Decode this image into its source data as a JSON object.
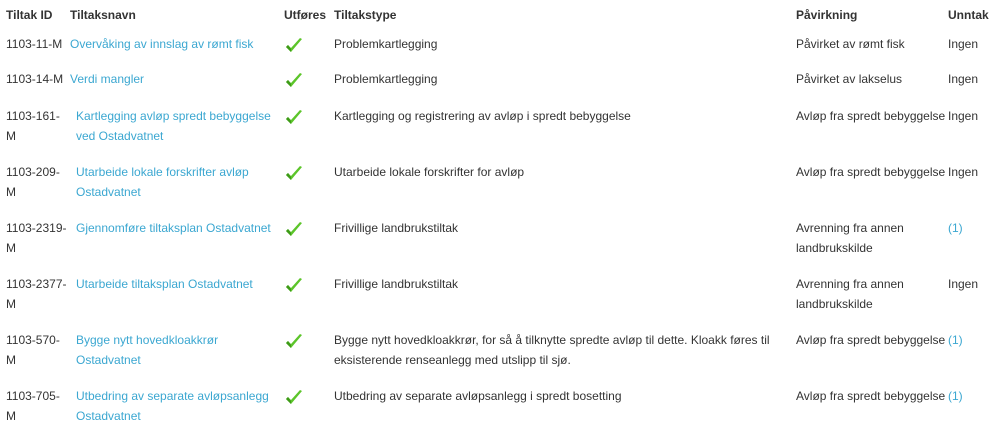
{
  "headers": {
    "id": "Tiltak ID",
    "name": "Tiltaksnavn",
    "executed": "Utføres",
    "type": "Tiltakstype",
    "impact": "Påvirkning",
    "exception": "Unntak"
  },
  "rows": [
    {
      "id": "1103-11-M",
      "name": "Overvåking av innslag av rømt fisk",
      "executed": "check-icon",
      "type": "Problemkartlegging",
      "impact": "Påvirket av rømt fisk",
      "exception": "Ingen"
    },
    {
      "id": "1103-14-M",
      "name": "Verdi mangler",
      "executed": "check-icon",
      "type": "Problemkartlegging",
      "impact": "Påvirket av lakselus",
      "exception": "Ingen"
    },
    {
      "id": "1103-161-M",
      "name": "Kartlegging avløp spredt bebyggelse ved Ostadvatnet",
      "executed": "check-icon",
      "type": "Kartlegging og registrering av avløp i spredt bebyggelse",
      "impact": "Avløp fra spredt bebyggelse",
      "exception": "Ingen"
    },
    {
      "id": "1103-209-M",
      "name": "Utarbeide lokale forskrifter avløp Ostadvatnet",
      "executed": "check-icon",
      "type": "Utarbeide lokale forskrifter for avløp",
      "impact": "Avløp fra spredt bebyggelse",
      "exception": "Ingen"
    },
    {
      "id": "1103-2319-M",
      "name": "Gjennomføre tiltaksplan Ostadvatnet",
      "executed": "check-icon",
      "type": "Frivillige landbrukstiltak",
      "impact": "Avrenning fra annen landbrukskilde",
      "exception": "(1)"
    },
    {
      "id": "1103-2377-M",
      "name": "Utarbeide tiltaksplan Ostadvatnet",
      "executed": "check-icon",
      "type": "Frivillige landbrukstiltak",
      "impact": "Avrenning fra annen landbrukskilde",
      "exception": "Ingen"
    },
    {
      "id": "1103-570-M",
      "name": "Bygge nytt hovedkloakkrør Ostadvatnet",
      "executed": "check-icon",
      "type": "Bygge nytt hovedkloakkrør, for så å tilknytte spredte avløp til dette. Kloakk føres til eksisterende renseanlegg med utslipp til sjø.",
      "impact": "Avløp fra spredt bebyggelse",
      "exception": "(1)"
    },
    {
      "id": "1103-705-M",
      "name": "Utbedring av separate avløpsanlegg Ostadvatnet",
      "executed": "check-icon",
      "type": "Utbedring av separate avløpsanlegg i spredt bosetting",
      "impact": "Avløp fra spredt bebyggelse",
      "exception": "(1)"
    }
  ],
  "colors": {
    "link": "#3ba7d1",
    "text": "#333333",
    "check": "#5cc52a"
  }
}
